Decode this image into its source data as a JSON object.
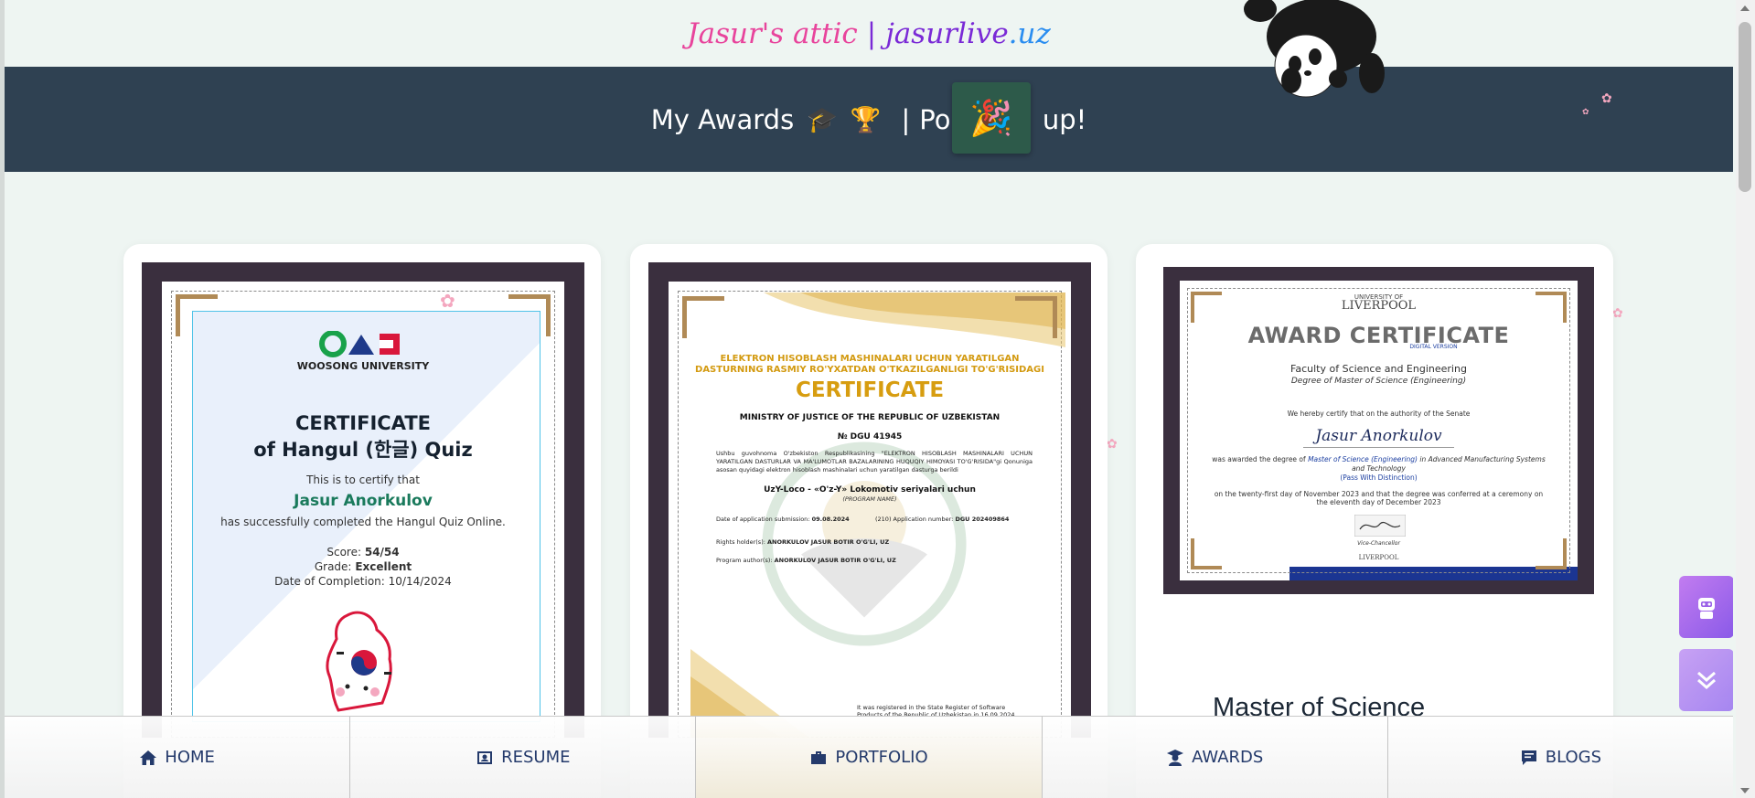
{
  "site": {
    "title_part1": "Jasur's attic",
    "title_sep": "|",
    "title_part2": "jasurlive",
    "title_part3": ".uz"
  },
  "banner": {
    "text_left": "My Awards",
    "emoji_grad": "🎓",
    "emoji_trophy": "🏆",
    "sep": "|",
    "text_pop": "Pop",
    "text_up": "up!",
    "confetti_emoji": "🎉"
  },
  "cert1": {
    "org": "WOOSONG UNIVERSITY",
    "title_line1": "CERTIFICATE",
    "title_line2": "of Hangul (한글) Quiz",
    "certify": "This is to certify that",
    "name": "Jasur Anorkulov",
    "completed": "has successfully completed the Hangul Quiz Online.",
    "score_label": "Score:",
    "score_value": "54/54",
    "grade_label": "Grade:",
    "grade_value": "Excellent",
    "date_label": "Date of Completion:",
    "date_value": "10/14/2024"
  },
  "cert2": {
    "head1": "ELEKTRON HISOBLASH MASHINALARI UCHUN YARATILGAN",
    "head2": "DASTURNING RASMIY RO'YXATDAN O'TKAZILGANLIGI TO'G'RISIDAGI",
    "title": "CERTIFICATE",
    "ministry": "MINISTRY OF JUSTICE OF THE REPUBLIC OF UZBEKISTAN",
    "number": "№ DGU 41945",
    "body": "Ushbu guvohnoma O'zbekiston Respublikasining \"ELEKTRON HISOBLASH MASHINALARI UCHUN YARATILGAN DASTURLAR VA MA'LUMOTLAR BAZALARINING HUQUQIY HIMOYASI TO'G'RISIDA\"gi Qonuniga asosan quyidagi elektron hisoblash mashinalari uchun yaratilgan dasturga berildi",
    "program": "UzY-Loco - «O'z-Y» Lokomotiv seriyalari uchun",
    "program_label": "(PROGRAM NAME)",
    "date_label": "Date of application submission:",
    "date_value": "09.08.2024",
    "appnum_label": "(210) Application number:",
    "appnum_value": "DGU 202409864",
    "holder_label": "Rights holder(s):",
    "holder_value": "ANORKULOV JASUR BOTIR O'G'LI, UZ",
    "author_label": "Program author(s):",
    "author_value": "ANORKULOV JASUR BOTIR O'G'LI, UZ",
    "registered": "It was registered in the State Register of Software Products of the Republic of Uzbekistan in 16.09.2024."
  },
  "cert3": {
    "university_small": "UNIVERSITY OF",
    "university": "LIVERPOOL",
    "title": "AWARD CERTIFICATE",
    "digital": "DIGITAL VERSION",
    "faculty": "Faculty of Science and Engineering",
    "degree": "Degree of Master of Science (Engineering)",
    "certify": "We hereby certify that on the authority of the Senate",
    "name": "Jasur Anorkulov",
    "awarded_prefix": "was awarded the degree of",
    "awarded_degree": "Master of Science (Engineering)",
    "awarded_suffix": "in Advanced Manufacturing Systems and Technology",
    "distinction": "(Pass With Distinction)",
    "date_line": "on the twenty-first day of November 2023 and that the degree was conferred at a ceremony on the eleventh day of December 2023",
    "signer": "Vice-Chancellor",
    "heading": "Master of Science"
  },
  "nav": {
    "items": [
      {
        "label": "HOME",
        "icon": "home-icon"
      },
      {
        "label": "RESUME",
        "icon": "id-card-icon"
      },
      {
        "label": "PORTFOLIO",
        "icon": "briefcase-icon"
      },
      {
        "label": "AWARDS",
        "icon": "graduate-icon"
      },
      {
        "label": "BLOGS",
        "icon": "comment-icon"
      }
    ],
    "active": "PORTFOLIO"
  },
  "colors": {
    "banner_bg": "#2f4152",
    "page_bg": "#eef5f2",
    "accent_pink": "#e8449c",
    "accent_purple": "#7a2ad6",
    "accent_blue": "#2a8df0",
    "nav_text": "#243a6b",
    "fab_purple": "#a86ae8"
  }
}
